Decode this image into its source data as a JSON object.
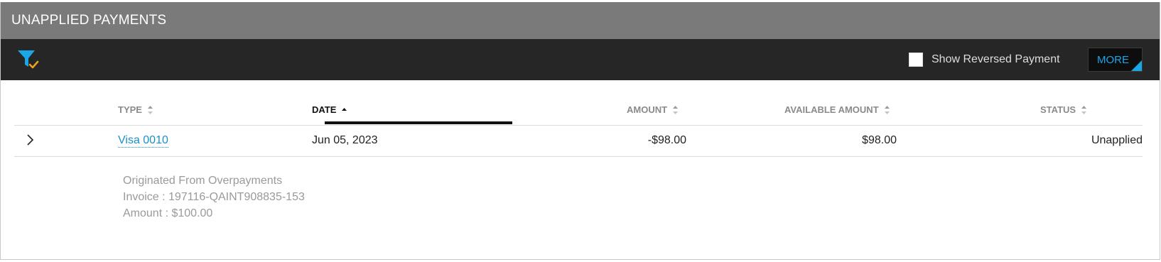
{
  "panel": {
    "title": "UNAPPLIED PAYMENTS"
  },
  "toolbar": {
    "filter_icon": "filter-check-icon",
    "show_reversed_label": "Show Reversed Payment",
    "show_reversed_checked": false,
    "more_label": "MORE"
  },
  "colors": {
    "header_bg": "#7a7a7a",
    "toolbar_bg": "#262626",
    "accent": "#1aa7e8",
    "link": "#1b8fc8",
    "filter_check": "#f0a020"
  },
  "table": {
    "columns": {
      "type": "TYPE",
      "date": "DATE",
      "amount": "AMOUNT",
      "available_amount": "AVAILABLE AMOUNT",
      "status": "STATUS"
    },
    "sorted_column": "date",
    "sort_direction": "ascending",
    "rows": [
      {
        "type": "Visa 0010",
        "date": "Jun 05, 2023",
        "amount": "-$98.00",
        "available_amount": "$98.00",
        "status": "Unapplied",
        "details": {
          "origin": "Originated From Overpayments",
          "invoice": "Invoice : 197116-QAINT908835-153",
          "amount": "Amount : $100.00"
        }
      }
    ]
  }
}
